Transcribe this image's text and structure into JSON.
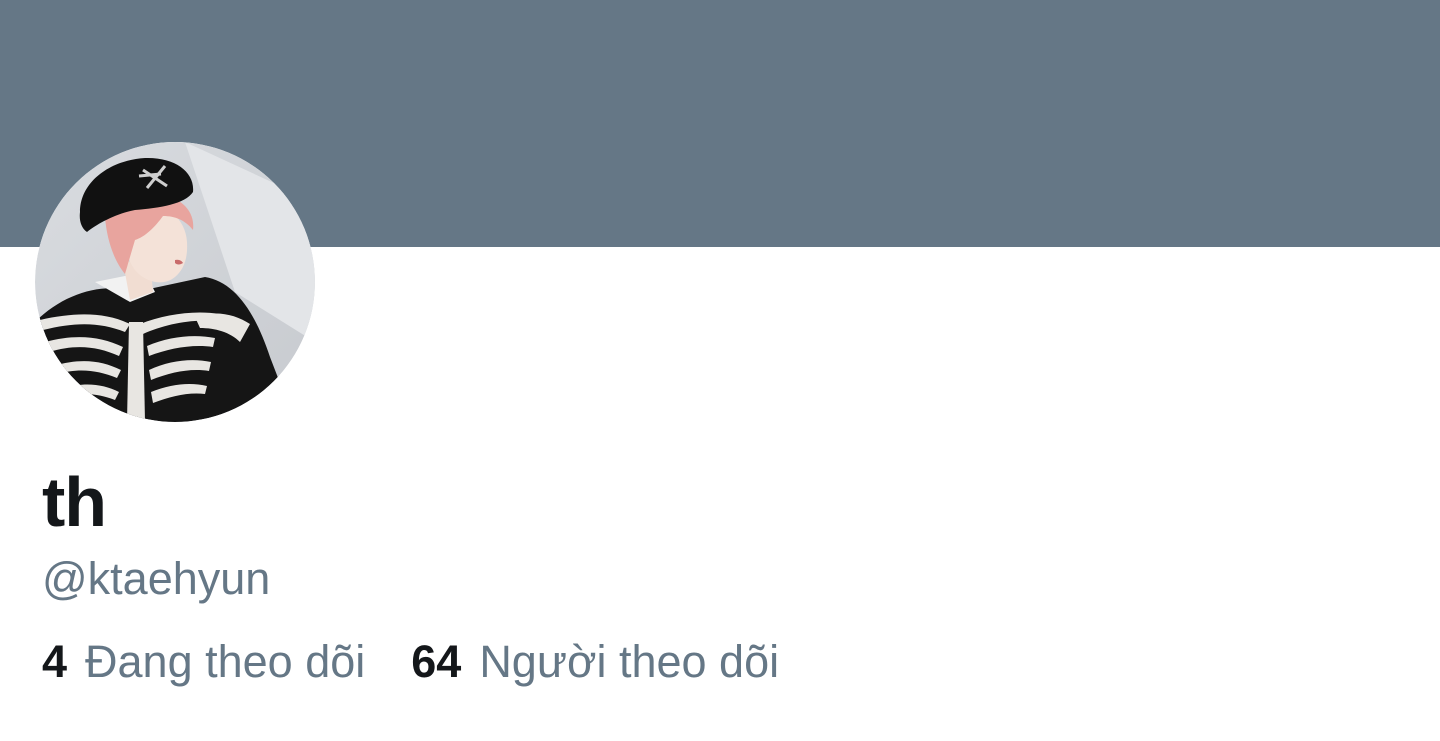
{
  "profile": {
    "display_name": "th",
    "handle": "@ktaehyun",
    "banner_color": "#657786",
    "avatar_icon": "profile-photo"
  },
  "stats": {
    "following_count": "4",
    "following_label": "Đang theo dõi",
    "followers_count": "64",
    "followers_label": "Người theo dõi"
  },
  "colors": {
    "text_primary": "#14171a",
    "text_secondary": "#657786"
  }
}
